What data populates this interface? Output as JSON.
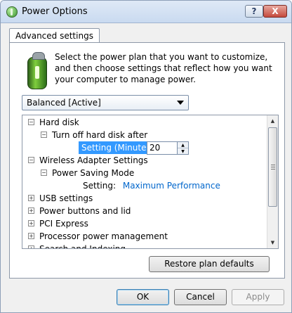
{
  "window": {
    "title": "Power Options",
    "help_label": "?",
    "close_label": "X"
  },
  "tab": {
    "label": "Advanced settings"
  },
  "intro_text": "Select the power plan that you want to customize, and then choose settings that reflect how you want your computer to manage power.",
  "plan_select": {
    "value": "Balanced [Active]"
  },
  "tree": {
    "items": [
      {
        "label": "Hard disk",
        "expander": "−"
      },
      {
        "label": "Turn off hard disk after",
        "expander": "−"
      },
      {
        "label": "Setting (Minutes):",
        "value": "20"
      },
      {
        "label": "Wireless Adapter Settings",
        "expander": "−"
      },
      {
        "label": "Power Saving Mode",
        "expander": "−"
      },
      {
        "label": "Setting:",
        "value": "Maximum Performance"
      },
      {
        "label": "USB settings",
        "expander": "+"
      },
      {
        "label": "Power buttons and lid",
        "expander": "+"
      },
      {
        "label": "PCI Express",
        "expander": "+"
      },
      {
        "label": "Processor power management",
        "expander": "+"
      },
      {
        "label": "Search and Indexing",
        "expander": "+"
      }
    ]
  },
  "buttons": {
    "restore": "Restore plan defaults",
    "ok": "OK",
    "cancel": "Cancel",
    "apply": "Apply"
  },
  "colors": {
    "selection": "#3399ff",
    "link": "#0066cc"
  }
}
